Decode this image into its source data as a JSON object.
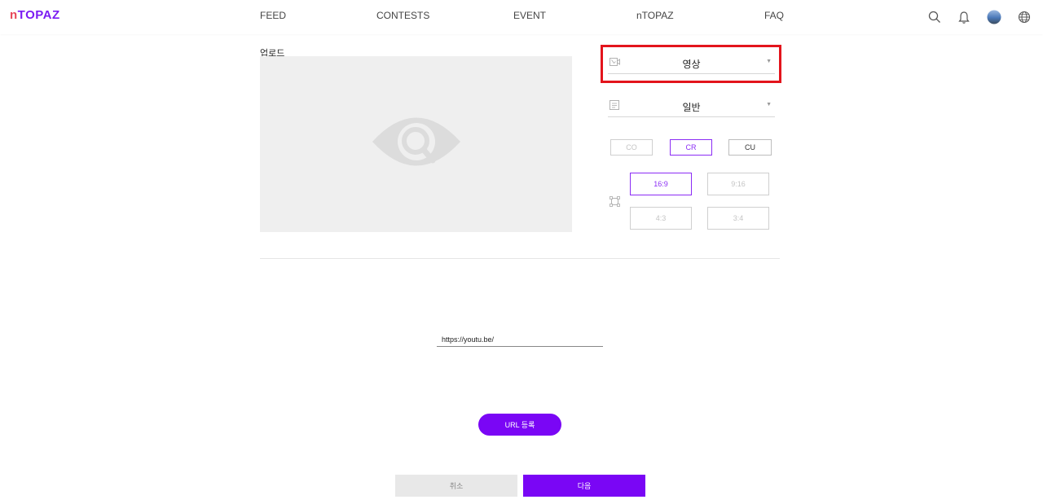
{
  "header": {
    "logo_n": "n",
    "logo_rest": "TOPAZ",
    "nav": [
      "FEED",
      "CONTESTS",
      "EVENT",
      "nTOPAZ",
      "FAQ"
    ],
    "icons": [
      "search-icon",
      "bell-icon",
      "avatar",
      "globe-icon"
    ]
  },
  "upload": {
    "label": "업로드",
    "preview_icon": "eye-search-icon"
  },
  "selects": {
    "media_type": "영상",
    "category": "일반"
  },
  "license_options": [
    "CO",
    "CR",
    "CU"
  ],
  "license_selected": "CR",
  "ratio_options": [
    "16:9",
    "9:16",
    "4:3",
    "3:4"
  ],
  "ratio_selected": "16:9",
  "url_field": {
    "value": "https://youtu.be/"
  },
  "buttons": {
    "url_register": "URL 등록",
    "cancel": "취소",
    "next": "다음"
  },
  "colors": {
    "accent": "#7a06f5",
    "highlight": "#e3141c",
    "logo_n": "#e7465b"
  }
}
